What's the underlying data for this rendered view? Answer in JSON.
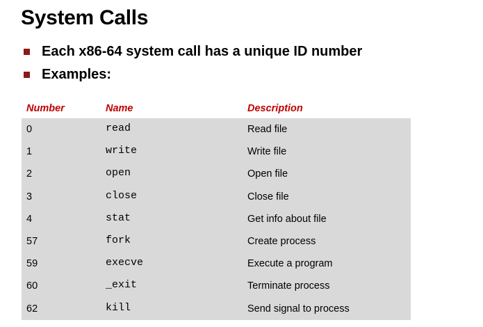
{
  "slide": {
    "title": "System Calls",
    "bullets": [
      "Each x86-64 system call has a unique ID number",
      "Examples:"
    ],
    "accent_color": "#c00000",
    "bullet_color": "#8b1a1a",
    "table_background": "#d9d9d9"
  },
  "table": {
    "headers": {
      "number": "Number",
      "name": "Name",
      "description": "Description"
    },
    "rows": [
      {
        "number": "0",
        "name": "read",
        "description": "Read file"
      },
      {
        "number": "1",
        "name": "write",
        "description": "Write file"
      },
      {
        "number": "2",
        "name": "open",
        "description": "Open file"
      },
      {
        "number": "3",
        "name": "close",
        "description": "Close file"
      },
      {
        "number": "4",
        "name": "stat",
        "description": "Get info about file"
      },
      {
        "number": "57",
        "name": "fork",
        "description": "Create process"
      },
      {
        "number": "59",
        "name": "execve",
        "description": "Execute a program"
      },
      {
        "number": "60",
        "name": "_exit",
        "description": "Terminate process"
      },
      {
        "number": "62",
        "name": "kill",
        "description": "Send signal to process"
      }
    ]
  }
}
